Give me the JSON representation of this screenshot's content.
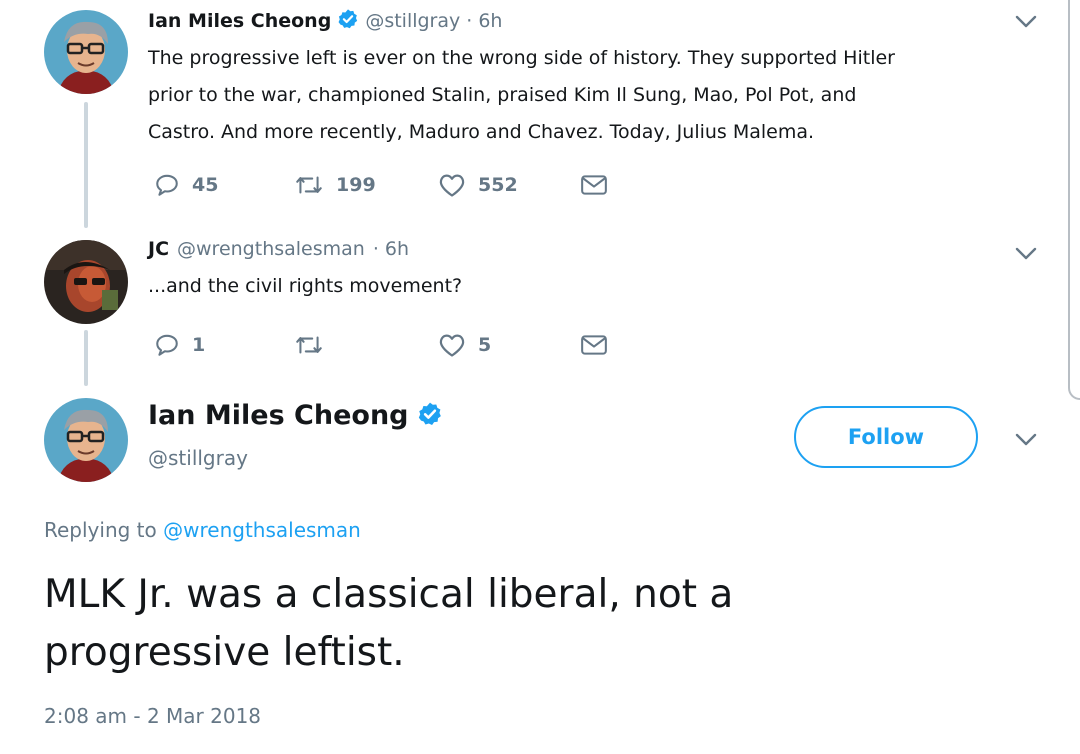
{
  "tweets": [
    {
      "name": "Ian Miles Cheong",
      "handle": "@stillgray",
      "time": "· 6h",
      "lines": [
        "The progressive left is ever on the wrong side of history. They supported Hitler",
        "prior to the war, championed Stalin, praised Kim Il Sung, Mao, Pol Pot, and",
        "Castro. And more recently, Maduro and Chavez. Today, Julius Malema."
      ],
      "replies": "45",
      "retweets": "199",
      "likes": "552"
    },
    {
      "name": "JC",
      "handle": "@wrengthsalesman",
      "time": "· 6h",
      "lines": [
        "...and the civil rights movement?"
      ],
      "replies": "1",
      "retweets": "",
      "likes": "5"
    }
  ],
  "main_tweet": {
    "name": "Ian Miles Cheong",
    "handle": "@stillgray",
    "follow_label": "Follow",
    "replying_prefix": "Replying to",
    "replying_to": "@wrengthsalesman",
    "lines": [
      "MLK Jr. was a classical liberal, not a",
      "progressive leftist."
    ],
    "timestamp": "2:08 am - 2 Mar 2018"
  },
  "icons": {
    "reply": "reply-icon",
    "retweet": "retweet-icon",
    "like": "heart-icon",
    "dm": "envelope-icon",
    "more": "chevron-down-icon",
    "verified": "verified-badge-icon"
  },
  "colors": {
    "accent": "#1da1f2",
    "text": "#14171a",
    "secondary": "#657786",
    "thread_line": "#ccd6dd"
  }
}
